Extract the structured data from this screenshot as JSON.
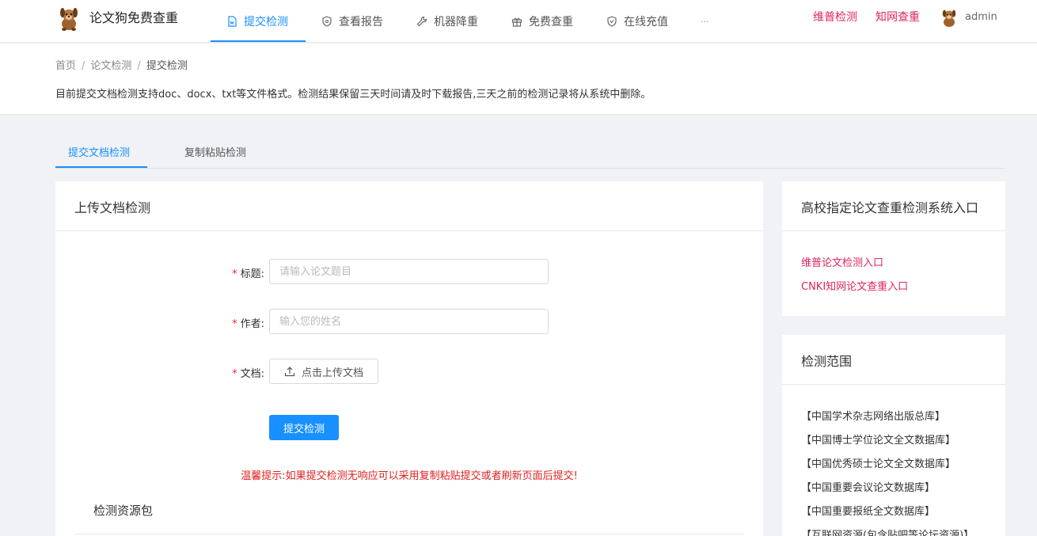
{
  "nav": {
    "brand": "论文狗免费查重",
    "menu": [
      {
        "label": "提交检测",
        "icon": "file-word-icon"
      },
      {
        "label": "查看报告",
        "icon": "shield-icon"
      },
      {
        "label": "机器降重",
        "icon": "wrench-icon"
      },
      {
        "label": "免费查重",
        "icon": "gift-icon"
      },
      {
        "label": "在线充值",
        "icon": "shield-check-icon"
      },
      {
        "label": "···",
        "icon": ""
      }
    ],
    "links": [
      "维普检测",
      "知网查重"
    ],
    "username": "admin"
  },
  "breadcrumb": [
    "首页",
    "论文检测",
    "提交检测"
  ],
  "notice": "目前提交文档检测支持doc、docx、txt等文件格式。检测结果保留三天时间请及时下载报告,三天之前的检测记录将从系统中删除。",
  "tabs": [
    "提交文档检测",
    "复制粘贴检测"
  ],
  "upload_card": {
    "title": "上传文档检测",
    "required_mark": "*",
    "title_label": "标题:",
    "title_placeholder": "请输入论文题目",
    "author_label": "作者:",
    "author_placeholder": "输入您的姓名",
    "doc_label": "文档:",
    "upload_label": "点击上传文档",
    "submit_label": "提交检测",
    "tip": "温馨提示:如果提交检测无响应可以采用复制粘贴提交或者刷新页面后提交!",
    "resource_title": "检测资源包"
  },
  "entry_card": {
    "title": "高校指定论文查重检测系统入口",
    "links": [
      "维普论文检测入口",
      "CNKI知网论文查重入口"
    ]
  },
  "range_card": {
    "title": "检测范围",
    "items": [
      "【中国学术杂志网络出版总库】",
      "【中国博士学位论文全文数据库】",
      "【中国优秀硕士论文全文数据库】",
      "【中国重要会议论文数据库】",
      "【中国重要报纸全文数据库】",
      "【互联网资源(包含贴吧等论坛资源)】"
    ]
  },
  "colors": {
    "accent": "#1890ff",
    "link": "#e0245e",
    "warning": "#e02020"
  }
}
